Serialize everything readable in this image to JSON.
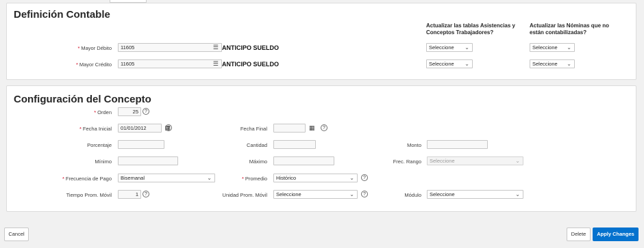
{
  "contable": {
    "title": "Definición Contable",
    "col_asistencias": "Actualizar las tablas Asistencias y Conceptos Trabajadores?",
    "col_nominas": "Actualizar las Nóminas que no están contabilizadas?",
    "mayor_debito": {
      "label": "Mayor Débito",
      "value": "11605",
      "desc": "ANTICIPO SUELDO"
    },
    "mayor_credito": {
      "label": "Mayor Crédito",
      "value": "11605",
      "desc": "ANTICIPO SUELDO"
    },
    "select_placeholder": "Seleccione"
  },
  "concepto": {
    "title": "Configuración del Concepto",
    "orden": {
      "label": "Orden",
      "value": "25"
    },
    "fecha_inicial": {
      "label": "Fecha Inicial",
      "value": "01/01/2012"
    },
    "fecha_final": {
      "label": "Fecha Final",
      "value": ""
    },
    "porcentaje": {
      "label": "Porcentaje",
      "value": ""
    },
    "cantidad": {
      "label": "Cantidad",
      "value": ""
    },
    "monto": {
      "label": "Monto",
      "value": ""
    },
    "minimo": {
      "label": "Mínimo",
      "value": ""
    },
    "maximo": {
      "label": "Máximo",
      "value": ""
    },
    "frec_rango": {
      "label": "Frec. Rango",
      "value": "Seleccione"
    },
    "frecuencia_pago": {
      "label": "Frecuencia de Pago",
      "value": "Bisemanal"
    },
    "promedio": {
      "label": "Promedio",
      "value": "Histórico"
    },
    "tiempo_prom_movil": {
      "label": "Tiempo Prom. Móvil",
      "value": "1"
    },
    "unidad_prom_movil": {
      "label": "Unidad Prom. Móvil",
      "value": "Seleccione"
    },
    "modulo": {
      "label": "Módulo",
      "value": "Seleccione"
    }
  },
  "footer": {
    "cancel": "Cancel",
    "delete": "Delete",
    "apply": "Apply Changes"
  },
  "icons": {
    "list": "list-icon",
    "calendar": "calendar-icon",
    "help": "help-icon",
    "chevron": "chevron-down-icon"
  },
  "colors": {
    "accent": "#0572ce",
    "required": "#d0021b"
  }
}
